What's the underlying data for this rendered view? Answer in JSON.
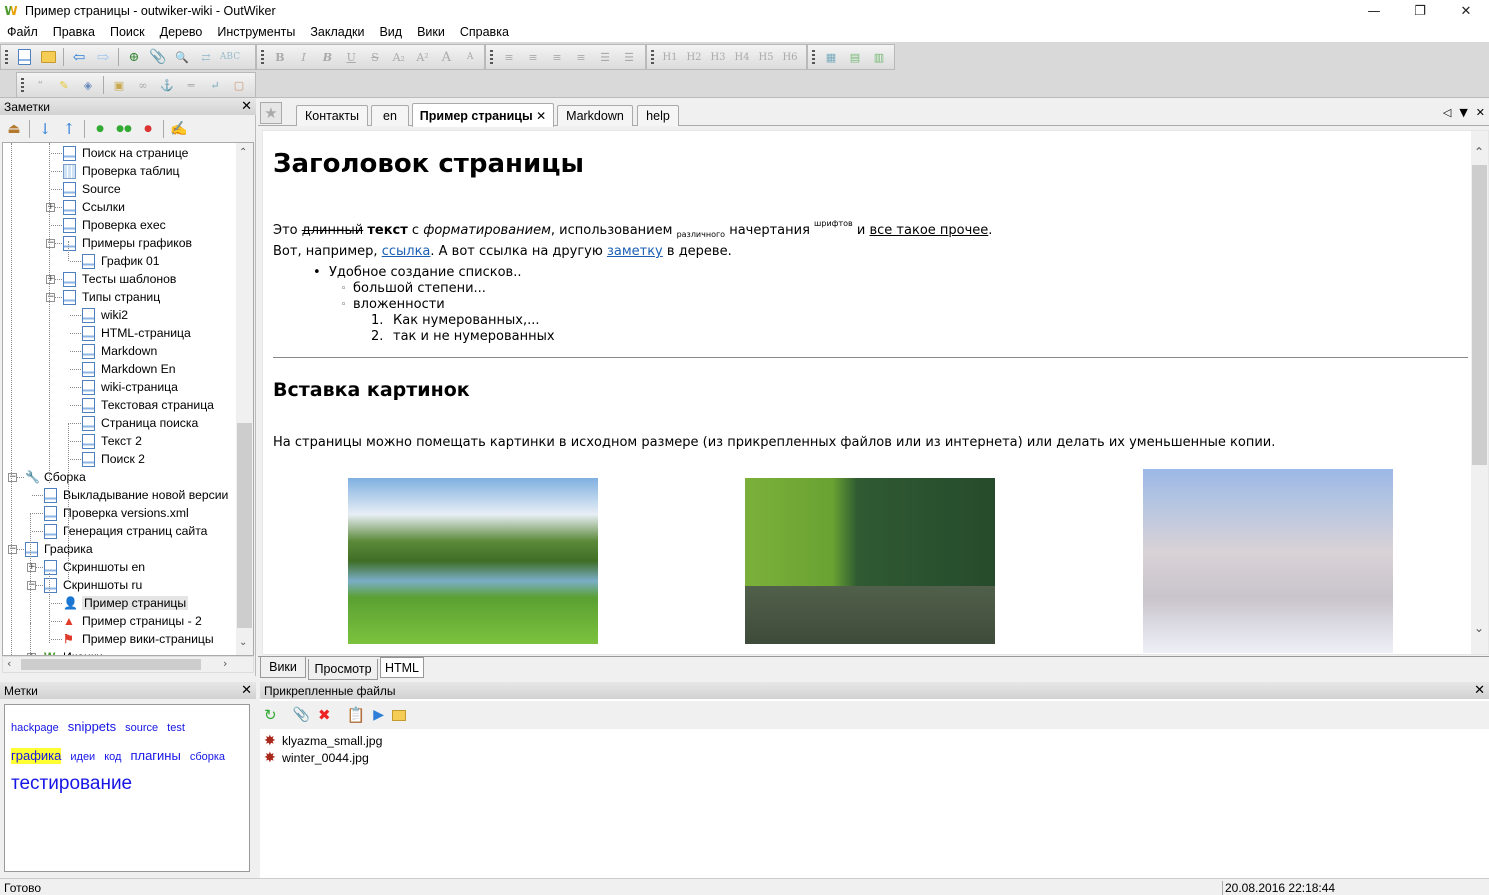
{
  "window": {
    "title": "Пример страницы - outwiker-wiki - OutWiker",
    "app_icon": "outwiker-logo-icon",
    "controls": [
      "minimize",
      "restore",
      "close"
    ]
  },
  "menu": [
    "Файл",
    "Правка",
    "Поиск",
    "Дерево",
    "Инструменты",
    "Закладки",
    "Вид",
    "Вики",
    "Справка"
  ],
  "toolbar": {
    "formatting": [
      "B",
      "I",
      "B",
      "U",
      "S",
      "A₂",
      "A²",
      "A",
      "A"
    ],
    "headings": [
      "H1",
      "H2",
      "H3",
      "H4",
      "H5",
      "H6"
    ]
  },
  "notes_panel": {
    "title": "Заметки",
    "close": "✕",
    "tree": [
      {
        "label": "Поиск на странице",
        "level": 2,
        "icon": "page-icon"
      },
      {
        "label": "Проверка таблиц",
        "level": 2,
        "icon": "table-icon"
      },
      {
        "label": "Source",
        "level": 2,
        "icon": "page-icon"
      },
      {
        "label": "Ссылки",
        "level": 2,
        "icon": "page-icon",
        "expander": "+"
      },
      {
        "label": "Проверка exec",
        "level": 2,
        "icon": "page-icon"
      },
      {
        "label": "Примеры графиков",
        "level": 2,
        "icon": "page-icon",
        "expander": "-"
      },
      {
        "label": "График 01",
        "level": 3,
        "icon": "page-icon"
      },
      {
        "label": "Тесты шаблонов",
        "level": 2,
        "icon": "page-icon",
        "expander": "+"
      },
      {
        "label": "Типы страниц",
        "level": 2,
        "icon": "page-icon",
        "expander": "-"
      },
      {
        "label": "wiki2",
        "level": 3,
        "icon": "page-icon"
      },
      {
        "label": "HTML-страница",
        "level": 3,
        "icon": "page-icon"
      },
      {
        "label": "Markdown",
        "level": 3,
        "icon": "page-icon"
      },
      {
        "label": "Markdown En",
        "level": 3,
        "icon": "page-icon"
      },
      {
        "label": "wiki-страница",
        "level": 3,
        "icon": "page-icon"
      },
      {
        "label": "Текстовая страница",
        "level": 3,
        "icon": "page-icon"
      },
      {
        "label": "Страница поиска",
        "level": 3,
        "icon": "page-icon"
      },
      {
        "label": "Текст 2",
        "level": 3,
        "icon": "page-icon"
      },
      {
        "label": "Поиск 2",
        "level": 3,
        "icon": "page-icon"
      },
      {
        "label": "Сборка",
        "level": 0,
        "icon": "wrench-icon",
        "expander": "-"
      },
      {
        "label": "Выкладывание новой версии",
        "level": 1,
        "icon": "page-icon"
      },
      {
        "label": "Проверка versions.xml",
        "level": 1,
        "icon": "page-icon"
      },
      {
        "label": "Генерация страниц сайта",
        "level": 1,
        "icon": "page-icon"
      },
      {
        "label": "Графика",
        "level": 0,
        "icon": "page-icon",
        "expander": "-"
      },
      {
        "label": "Скриншоты en",
        "level": 1,
        "icon": "page-icon",
        "expander": "+"
      },
      {
        "label": "Скриншоты ru",
        "level": 1,
        "icon": "page-icon",
        "expander": "-"
      },
      {
        "label": "Пример страницы",
        "level": 2,
        "icon": "user-icon",
        "selected": true
      },
      {
        "label": "Пример страницы - 2",
        "level": 2,
        "icon": "cone-icon"
      },
      {
        "label": "Пример вики-страницы",
        "level": 2,
        "icon": "flag-icon"
      },
      {
        "label": "Иконки",
        "level": 1,
        "icon": "outwiker-logo-icon",
        "expander": "+"
      }
    ]
  },
  "tags_panel": {
    "title": "Метки",
    "close": "✕",
    "tags": [
      {
        "label": "hackpage",
        "size": "s"
      },
      {
        "label": "snippets",
        "size": "m"
      },
      {
        "label": "source",
        "size": "s"
      },
      {
        "label": "test",
        "size": "s"
      },
      {
        "label": "графика",
        "size": "m",
        "highlighted": true
      },
      {
        "label": "идеи",
        "size": "s"
      },
      {
        "label": "код",
        "size": "s"
      },
      {
        "label": "плагины",
        "size": "m"
      },
      {
        "label": "сборка",
        "size": "s"
      },
      {
        "label": "тестирование",
        "size": "xl"
      }
    ]
  },
  "tabs": [
    {
      "label": "Контакты"
    },
    {
      "label": "en"
    },
    {
      "label": "Пример страницы",
      "active": true,
      "close": "✕"
    },
    {
      "label": "Markdown"
    },
    {
      "label": "help"
    }
  ],
  "page": {
    "h1": "Заголовок страницы",
    "p1": {
      "t1": "Это ",
      "strike": "длинный",
      "t2": " ",
      "bold": "текст",
      "t3": " с ",
      "italic": "форматированием",
      "t4": ", использованием ",
      "sub": "различного",
      "t5": " начертания ",
      "sup": "шрифтов",
      "t6": " и ",
      "underline": "все такое прочее",
      "t7": ".",
      "l2a": "Вот, например, ",
      "link1": "ссылка",
      "l2b": ". А вот ссылка на другую ",
      "link2": "заметку",
      "l2c": " в дереве."
    },
    "list": {
      "item1": "Удобное создание списков..",
      "sub1": "большой степени...",
      "sub2": "вложенности",
      "num1": "Как нумерованных,...",
      "num2": "так и не нумерованных"
    },
    "h2": "Вставка картинок",
    "p2": "На страницы можно помещать картинки в исходном размере (из прикрепленных файлов или из интернета) или делать их уменьшенные копии.",
    "images": [
      "river-landscape-photo",
      "lake-forest-photo",
      "winter-road-photo"
    ]
  },
  "view_tabs": [
    {
      "label": "Вики"
    },
    {
      "label": "Просмотр",
      "active": true
    },
    {
      "label": "HTML"
    }
  ],
  "attachments": {
    "title": "Прикрепленные файлы",
    "close": "✕",
    "files": [
      "klyazma_small.jpg",
      "winter_0044.jpg"
    ]
  },
  "status": {
    "text": "Готово",
    "datetime": "20.08.2016 22:18:44"
  }
}
